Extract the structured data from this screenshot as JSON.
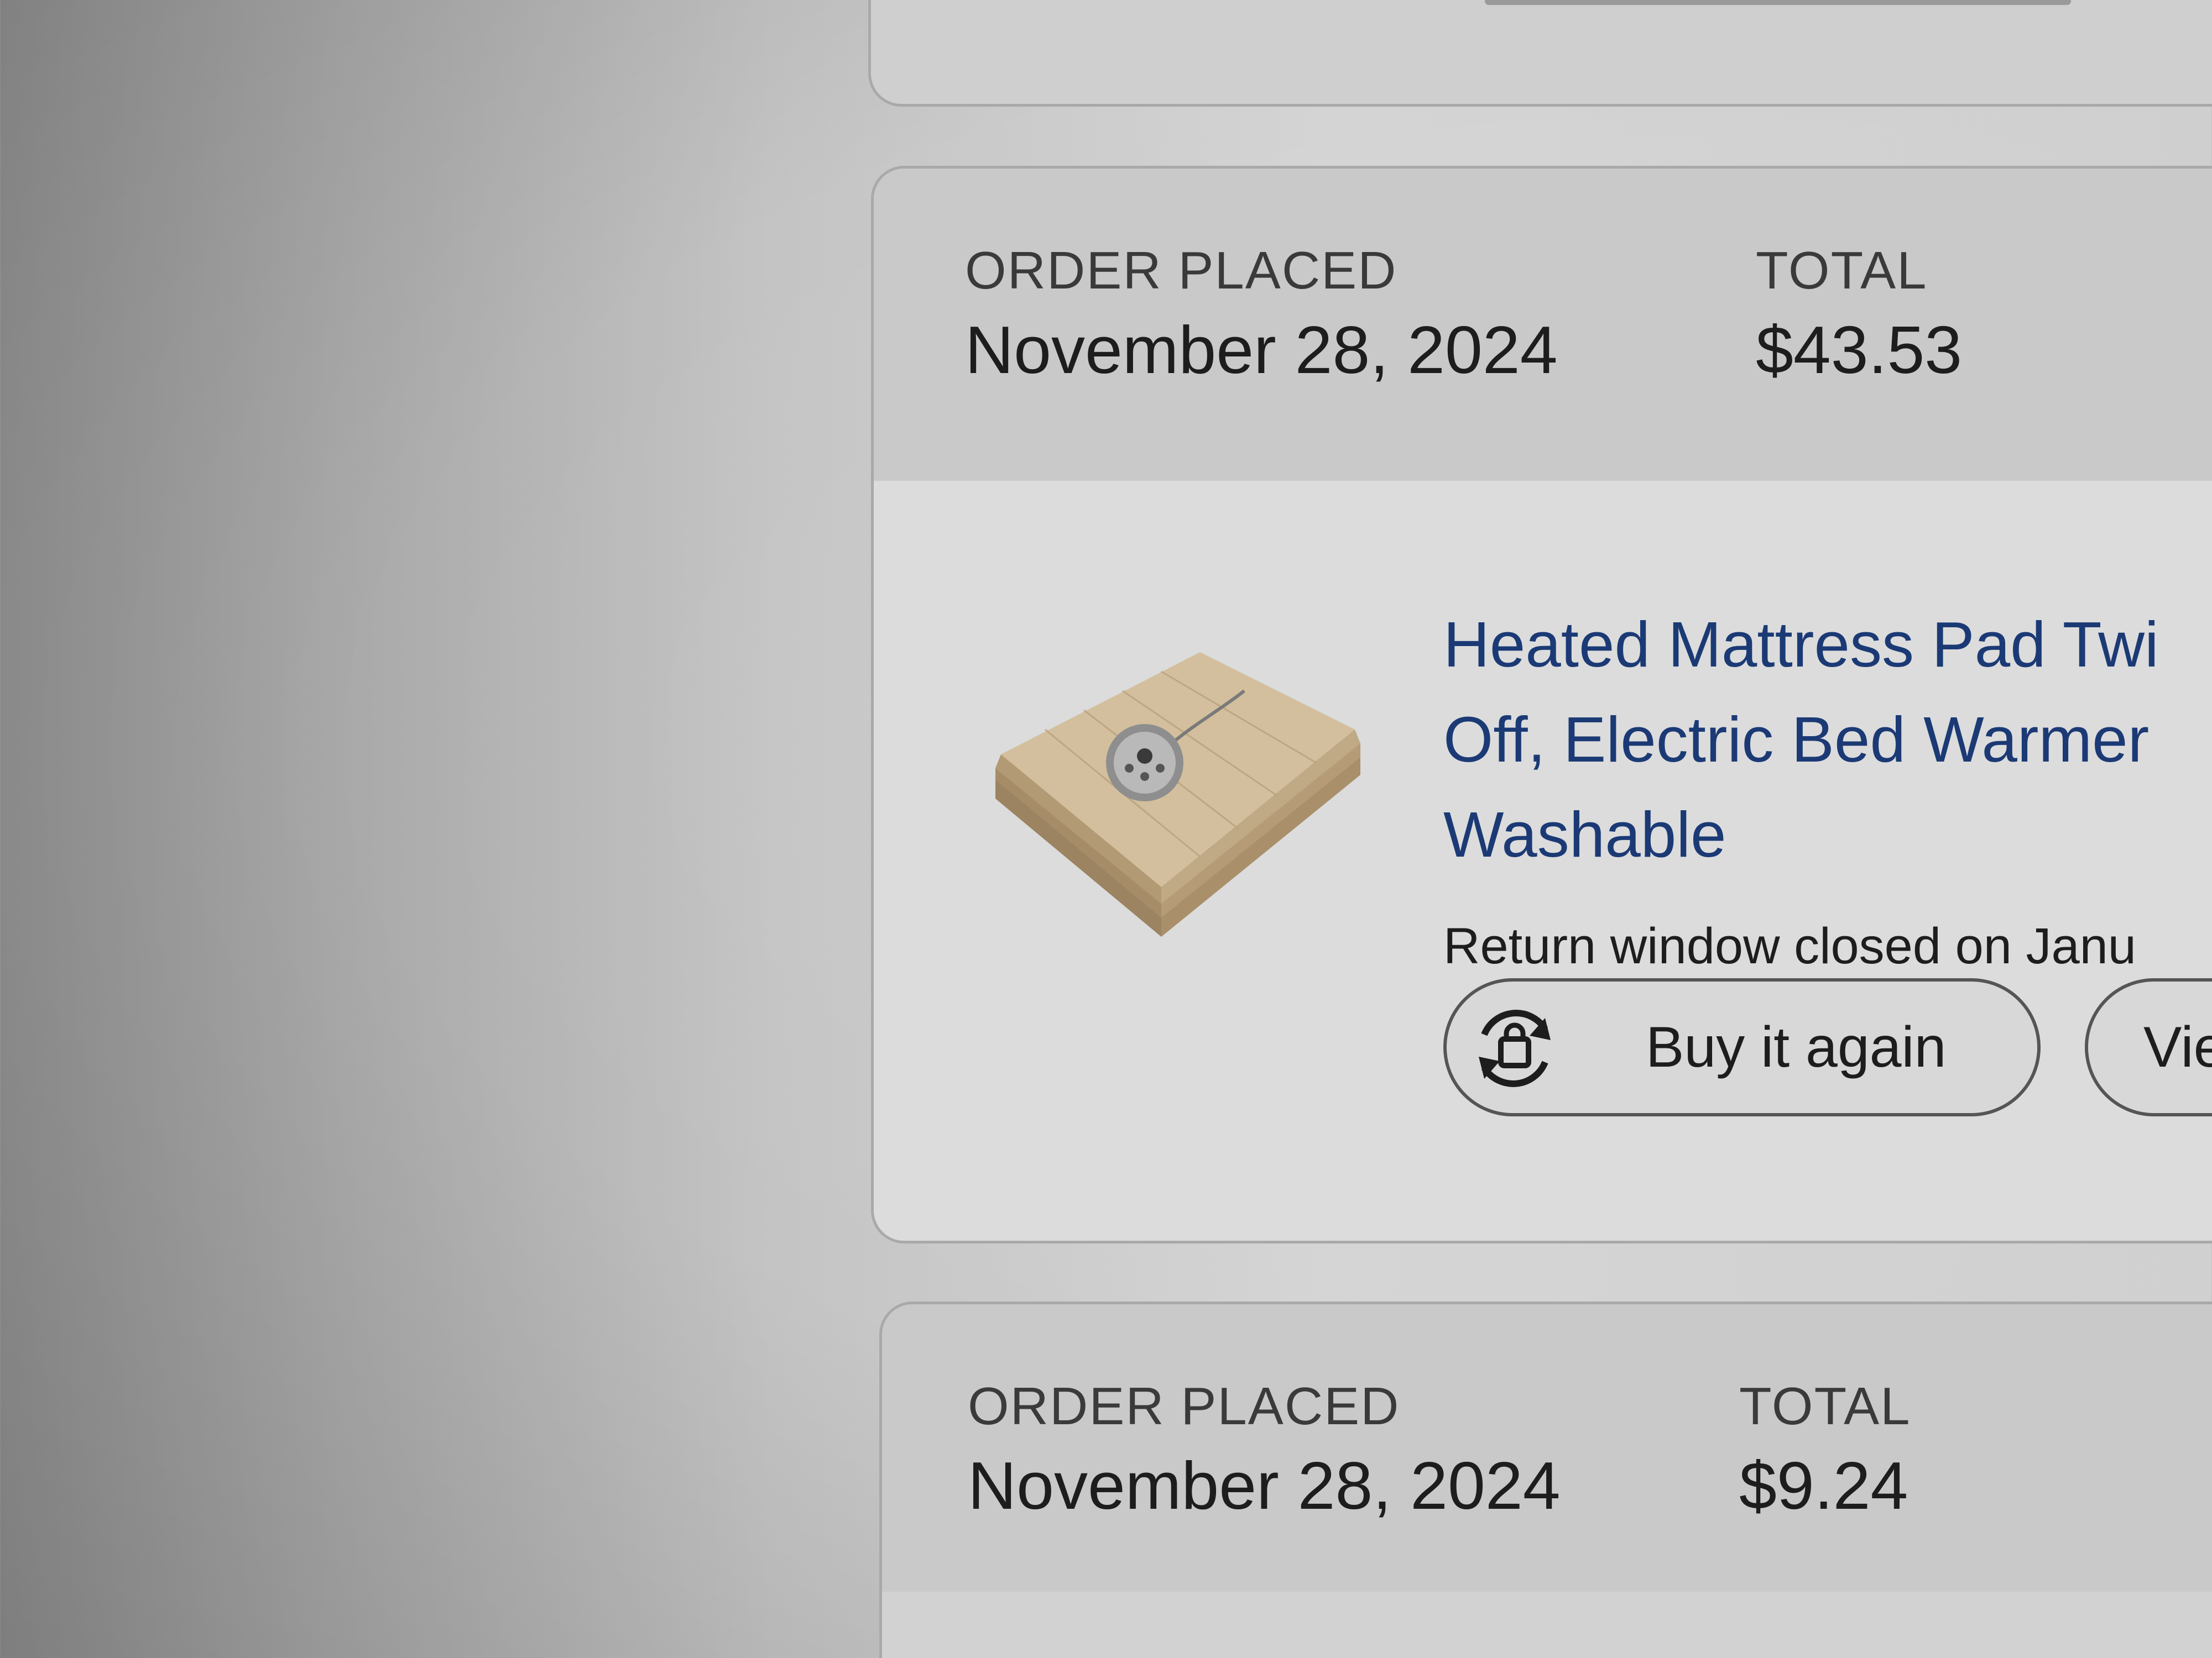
{
  "orders": [
    {
      "placed_label": "ORDER PLACED",
      "placed_date": "November 28, 2024",
      "total_label": "TOTAL",
      "total_value": "$43.53",
      "item": {
        "title": "Heated Mattress Pad Twi\nOff, Electric Bed Warmer\nWashable",
        "return_status": "Return window closed on Janu",
        "buy_again_label": "Buy it again",
        "view_label": "Vie",
        "thumbnail_icon": "heated-mattress-pad-image"
      }
    },
    {
      "placed_label": "ORDER PLACED",
      "placed_date": "November 28, 2024",
      "total_label": "TOTAL",
      "total_value": "$9.24"
    }
  ],
  "icons": {
    "buy_again": "buy-again-refresh-icon"
  },
  "colors": {
    "link_blue": "#1b3a75",
    "text_dark": "#1d1d1d",
    "header_gray": "#c9c9c9",
    "body_gray": "#dcdcdc"
  }
}
